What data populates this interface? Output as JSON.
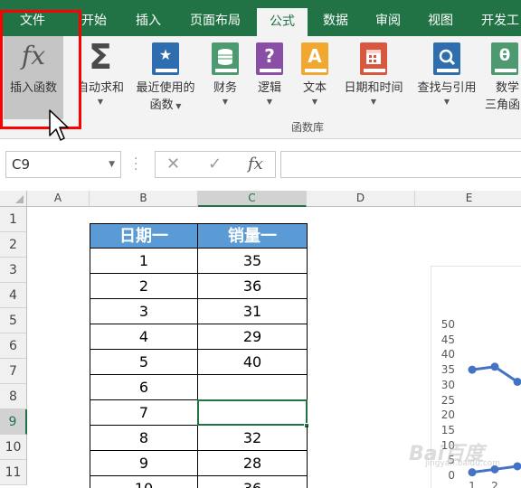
{
  "tabs": [
    "文件",
    "开始",
    "插入",
    "页面布局",
    "公式",
    "数据",
    "审阅",
    "视图",
    "开发工"
  ],
  "active_tab": "公式",
  "ribbon": {
    "insert_function": "插入函数",
    "autosum": "自动求和",
    "recent_1": "最近使用的",
    "recent_2": "函数",
    "financial": "财务",
    "logical": "逻辑",
    "text": "文本",
    "datetime": "日期和时间",
    "lookup": "查找与引用",
    "math_1": "数学",
    "math_2": "三角函",
    "group_label": "函数库",
    "icons": {
      "financial": "stack-of-coins-icon",
      "logical": "question-mark-icon",
      "text": "letter-a-icon",
      "datetime": "calendar-icon",
      "lookup": "magnifier-icon",
      "math": "theta-icon"
    },
    "glyphs": {
      "fx": "fx",
      "sigma": "Σ",
      "star": "★",
      "question": "?",
      "letter": "A",
      "theta": "θ"
    }
  },
  "formula_bar": {
    "name_box": "C9",
    "cancel_glyph": "✕",
    "enter_glyph": "✓",
    "fx_glyph": "fx"
  },
  "columns": [
    "A",
    "B",
    "C",
    "D",
    "E"
  ],
  "rows": [
    "1",
    "2",
    "3",
    "4",
    "5",
    "6",
    "7",
    "8",
    "9",
    "10",
    "11"
  ],
  "table": {
    "headers": [
      "日期一",
      "销量一"
    ],
    "rows": [
      [
        "1",
        "35"
      ],
      [
        "2",
        "36"
      ],
      [
        "3",
        "31"
      ],
      [
        "4",
        "29"
      ],
      [
        "5",
        "40"
      ],
      [
        "6",
        ""
      ],
      [
        "7",
        ""
      ],
      [
        "8",
        "32"
      ],
      [
        "9",
        "28"
      ],
      [
        "10",
        "36"
      ]
    ]
  },
  "chart_data": {
    "type": "line",
    "title": "",
    "ylim": [
      0,
      50
    ],
    "yticks": [
      "50",
      "45",
      "40",
      "35",
      "30",
      "25",
      "20",
      "15",
      "10",
      "5",
      "0"
    ],
    "xticks": [
      "1",
      "2"
    ],
    "series": [
      {
        "values": [
          35,
          36,
          31
        ]
      },
      {
        "values": [
          1,
          2,
          3
        ]
      }
    ]
  },
  "colors": {
    "ribbon_green": "#217346",
    "header_blue": "#5b9bd5",
    "highlight_red": "#ff0000",
    "series_blue": "#4472c4"
  },
  "watermark": "Bai百度",
  "watermark_url": "jingyan.baidu.com"
}
